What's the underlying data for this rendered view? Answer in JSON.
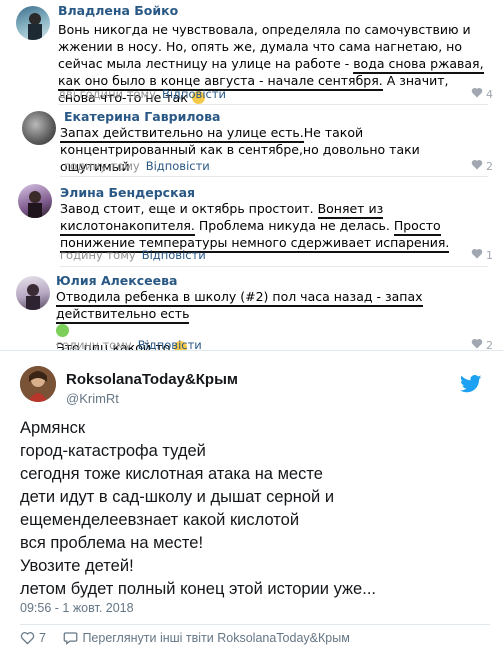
{
  "comments": [
    {
      "author": "Владлена Бойко",
      "text_parts": [
        "Вонь никогда не чувствовала, определяла по самочувствию и жжении в носу. Но, опять же, думала что сама нагнетаю, но сейчас мыла лестницу на улице на работе - ",
        "вода снова ржавая, как оно было в конце августа - начале сентября.",
        " А значит, снова что-то не так"
      ],
      "time": "дві години тому",
      "reply": "Відповісти",
      "likes": "4"
    },
    {
      "author": "Екатерина Гаврилова",
      "text_parts": [
        "Запах действительно на улице есть.",
        "Не такой концентрированный как в сентябре,но довольно таки ощутимый"
      ],
      "time": "годину тому",
      "reply": "Відповісти",
      "likes": "2"
    },
    {
      "author": "Элина Бендерская",
      "text_parts": [
        "Завод стоит, еще и октябрь простоит. ",
        "Воняет из кислотонакопителя.",
        " Проблема никуда не делась. ",
        "Просто понижение температуры немного сдерживает испарения."
      ],
      "time": "годину тому",
      "reply": "Відповісти",
      "likes": "1"
    },
    {
      "author": "Юлия Алексеева",
      "text_parts": [
        "Отводила ребенка в школу (#2) пол часа назад - запах действительно есть",
        "Это ппц какой-то"
      ],
      "time": "годину тому",
      "reply": "Відповісти",
      "likes": "2"
    }
  ],
  "tweet": {
    "name": "RoksolanaToday&Крым",
    "handle": "@KrimRt",
    "lines": [
      "Армянск",
      "город-катастрофа тудей",
      "сегодня тоже кислотная атака на месте",
      "дети идут в сад-школу и дышат серной и",
      "ещеменделеевзнает какой кислотой",
      "вся проблема на месте!",
      "Увозите детей!",
      "летом будет полный конец этой истории уже..."
    ],
    "time": "09:56 - 1 жовт. 2018",
    "likes": "7",
    "more_link": "Переглянути інші твіти RoksolanaToday&Крым"
  },
  "colors": {
    "vk_link": "#2a5885",
    "twitter_blue": "#1da1f2",
    "muted": "#939393"
  },
  "icons": [
    "heart-icon",
    "twitter-bird-icon",
    "reply-bubble-icon",
    "smile-emoji",
    "sick-emoji",
    "grin-emoji"
  ]
}
